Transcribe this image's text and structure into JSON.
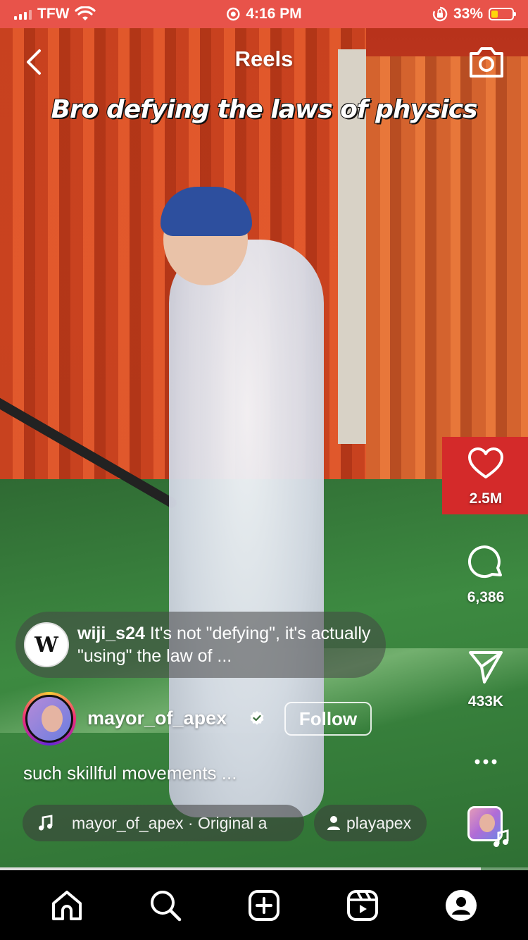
{
  "status_bar": {
    "carrier": "TFW",
    "time": "4:16 PM",
    "battery_percent": "33%",
    "battery_level": 0.33,
    "icons": [
      "signal-icon",
      "wifi-icon",
      "location-icon",
      "orientation-lock-icon",
      "battery-icon"
    ]
  },
  "header": {
    "title": "Reels",
    "back_icon": "chevron-left-icon",
    "camera_icon": "camera-icon"
  },
  "video": {
    "overlay_caption": "Bro defying the laws of physics",
    "progress": 0.91
  },
  "actions": {
    "like_count": "2.5M",
    "comment_count": "6,386",
    "share_count": "433K",
    "more_label": "..."
  },
  "top_comment": {
    "avatar_text": "W",
    "username": "wiji_s24",
    "text": " It's not \"defying\", it's actually \"using\" the law of ..."
  },
  "author": {
    "username": "mayor_of_apex",
    "verified": true,
    "follow_label": "Follow"
  },
  "post": {
    "caption": "such skillful movements ..."
  },
  "audio": {
    "label": "mayor_of_apex · Original a"
  },
  "tag": {
    "label": "playapex"
  },
  "bottom_nav": {
    "items": [
      "home-icon",
      "search-icon",
      "create-icon",
      "reels-icon",
      "profile-icon"
    ]
  },
  "colors": {
    "status_bar": "#e8534a",
    "battery": "#ffd60a",
    "nav_background": "#000000"
  }
}
